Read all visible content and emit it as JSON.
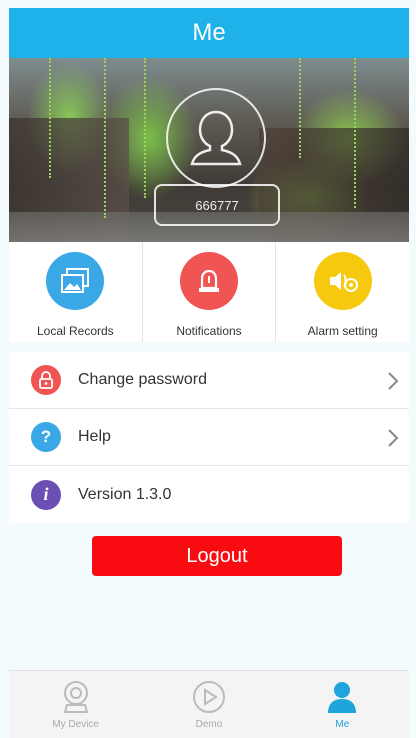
{
  "header": {
    "title": "Me"
  },
  "profile": {
    "user_id": "666777"
  },
  "quick_actions": [
    {
      "label": "Local Records",
      "icon": "image-gallery-icon",
      "color": "#3aa8e6"
    },
    {
      "label": "Notifications",
      "icon": "alarm-light-icon",
      "color": "#f05553"
    },
    {
      "label": "Alarm setting",
      "icon": "alarm-settings-icon",
      "color": "#f6c90e"
    }
  ],
  "menu": [
    {
      "label": "Change password",
      "icon": "lock-icon",
      "color": "#f05553"
    },
    {
      "label": "Help",
      "icon": "question-icon",
      "color": "#3aa8e6"
    },
    {
      "label": "Version 1.3.0",
      "icon": "info-icon",
      "color": "#6b4fb5"
    }
  ],
  "logout_label": "Logout",
  "tabs": [
    {
      "label": "My Device",
      "icon": "camera-icon"
    },
    {
      "label": "Demo",
      "icon": "play-icon"
    },
    {
      "label": "Me",
      "icon": "person-icon",
      "active": true
    }
  ],
  "colors": {
    "accent": "#1fb2ea",
    "logout": "#f90b12",
    "tab_active": "#1fa4dc"
  }
}
